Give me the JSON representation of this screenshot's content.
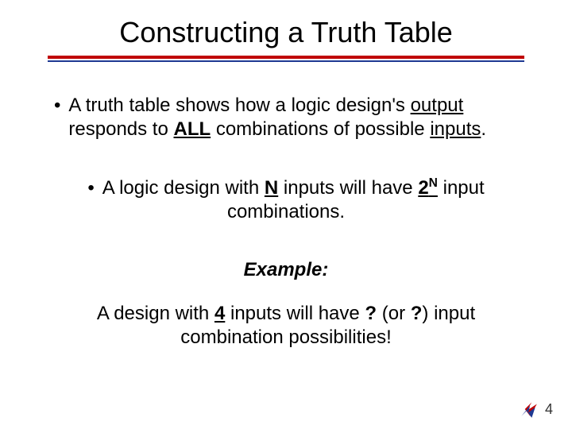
{
  "title": "Constructing a Truth Table",
  "bullet1_pre": "A truth table shows how a logic design's ",
  "bullet1_output": "output",
  "bullet1_mid": " responds to ",
  "bullet1_all": "ALL",
  "bullet1_mid2": " combinations of possible ",
  "bullet1_inputs": "inputs",
  "bullet1_end": ".",
  "bullet2_pre": "A logic design with ",
  "bullet2_N": "N",
  "bullet2_mid": " inputs will have ",
  "bullet2_two": "2",
  "bullet2_exp": "N",
  "bullet2_end": " input combinations.",
  "example_label": "Example:",
  "example_pre": "A design with ",
  "example_four": "4",
  "example_mid": " inputs will have ",
  "example_q1": "?",
  "example_mid2": " (or ",
  "example_q2": "?",
  "example_mid3": ") input combination possibilities!",
  "page_number": "4"
}
